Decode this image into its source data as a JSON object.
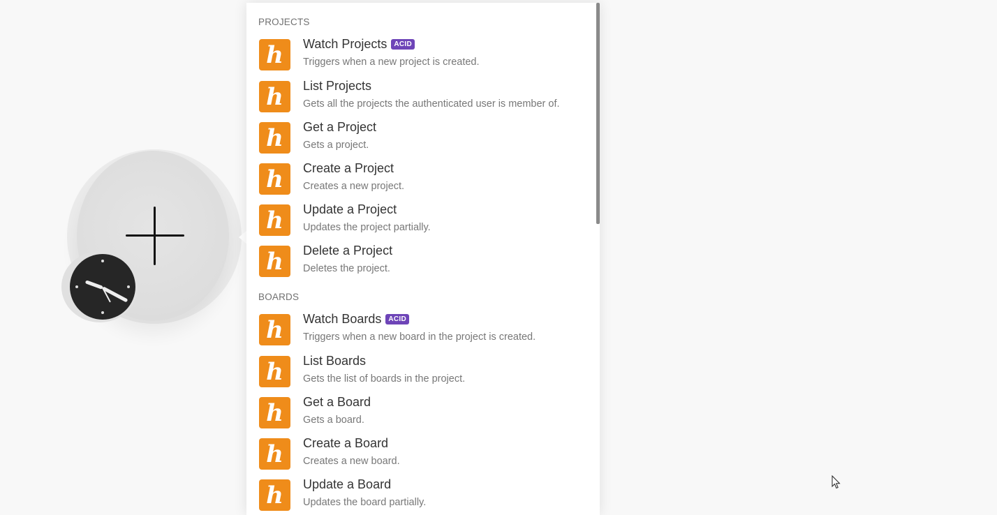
{
  "colors": {
    "app_icon_bg": "#ef8c1a",
    "badge_bg": "#6e45b8",
    "canvas_bg": "#f8f8f8"
  },
  "module": {
    "add_icon": "plus-icon",
    "trigger_icon": "clock-icon"
  },
  "app_icon_glyph": "h",
  "sections": [
    {
      "header": "PROJECTS",
      "items": [
        {
          "title": "Watch Projects",
          "badge": "ACID",
          "desc": "Triggers when a new project is created."
        },
        {
          "title": "List Projects",
          "badge": "",
          "desc": "Gets all the projects the authenticated user is member of."
        },
        {
          "title": "Get a Project",
          "badge": "",
          "desc": "Gets a project."
        },
        {
          "title": "Create a Project",
          "badge": "",
          "desc": "Creates a new project."
        },
        {
          "title": "Update a Project",
          "badge": "",
          "desc": "Updates the project partially."
        },
        {
          "title": "Delete a Project",
          "badge": "",
          "desc": "Deletes the project."
        }
      ]
    },
    {
      "header": "BOARDS",
      "items": [
        {
          "title": "Watch Boards",
          "badge": "ACID",
          "desc": "Triggers when a new board in the project is created."
        },
        {
          "title": "List Boards",
          "badge": "",
          "desc": "Gets the list of boards in the project."
        },
        {
          "title": "Get a Board",
          "badge": "",
          "desc": "Gets a board."
        },
        {
          "title": "Create a Board",
          "badge": "",
          "desc": "Creates a new board."
        },
        {
          "title": "Update a Board",
          "badge": "",
          "desc": "Updates the board partially."
        }
      ]
    }
  ]
}
